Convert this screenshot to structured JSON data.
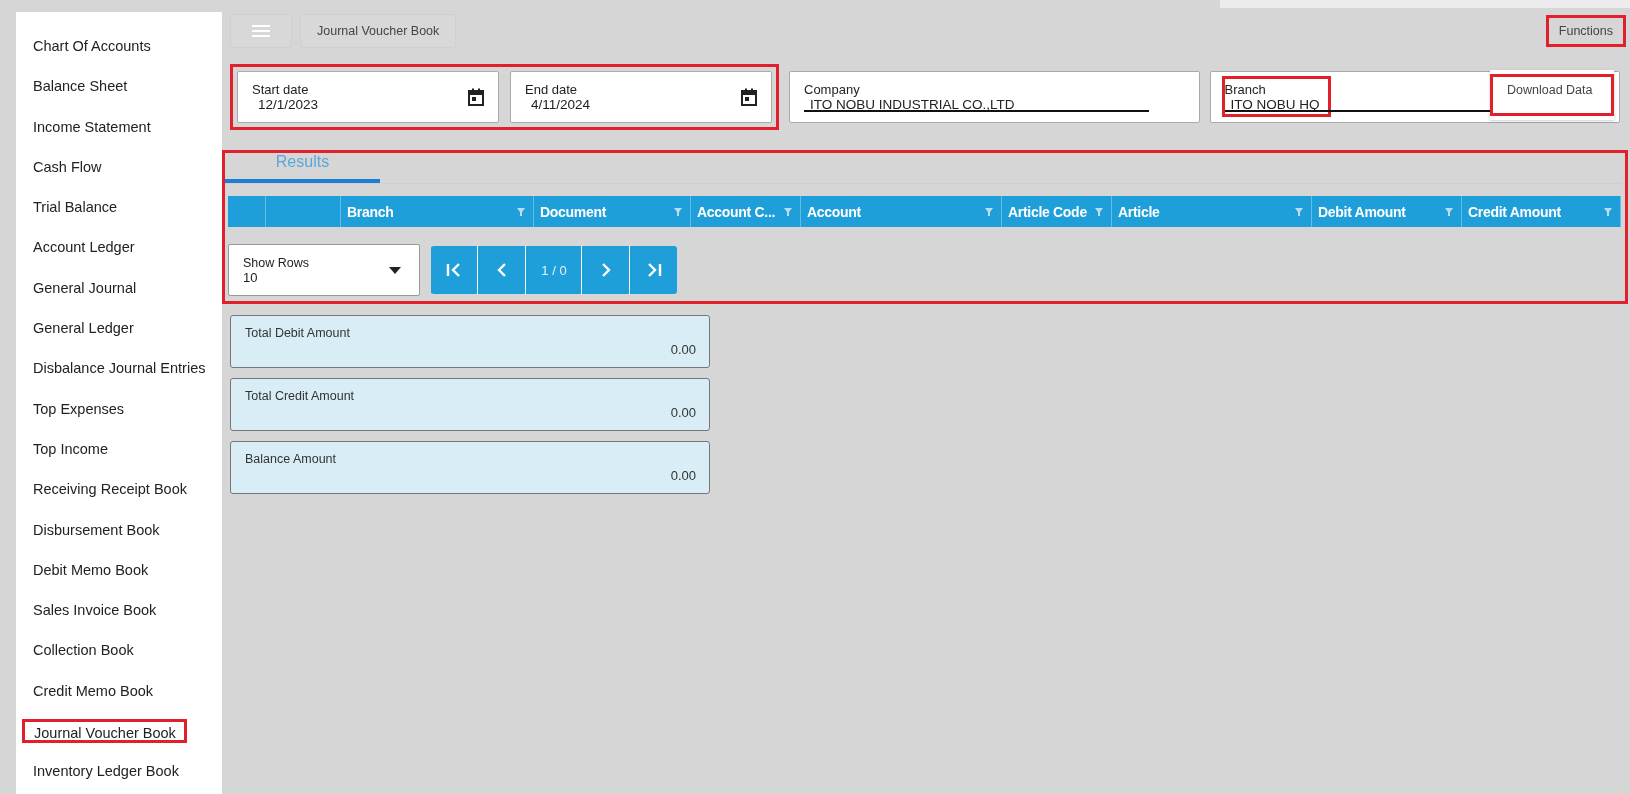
{
  "sidebar": {
    "items": [
      {
        "label": "Chart Of Accounts",
        "highlighted": false
      },
      {
        "label": "Balance Sheet",
        "highlighted": false
      },
      {
        "label": "Income Statement",
        "highlighted": false
      },
      {
        "label": "Cash Flow",
        "highlighted": false
      },
      {
        "label": "Trial Balance",
        "highlighted": false
      },
      {
        "label": "Account Ledger",
        "highlighted": false
      },
      {
        "label": "General Journal",
        "highlighted": false
      },
      {
        "label": "General Ledger",
        "highlighted": false
      },
      {
        "label": "Disbalance Journal Entries",
        "highlighted": false
      },
      {
        "label": "Top Expenses",
        "highlighted": false
      },
      {
        "label": "Top Income",
        "highlighted": false
      },
      {
        "label": "Receiving Receipt Book",
        "highlighted": false
      },
      {
        "label": "Disbursement Book",
        "highlighted": false
      },
      {
        "label": "Debit Memo Book",
        "highlighted": false
      },
      {
        "label": "Sales Invoice Book",
        "highlighted": false
      },
      {
        "label": "Collection Book",
        "highlighted": false
      },
      {
        "label": "Credit Memo Book",
        "highlighted": false
      },
      {
        "label": "Journal Voucher Book",
        "highlighted": true
      },
      {
        "label": "Inventory Ledger Book",
        "highlighted": false
      }
    ]
  },
  "toolbar": {
    "title": "Journal Voucher Book",
    "functions": {
      "label": "Functions",
      "highlighted": true
    },
    "menu": [
      {
        "label": "Download Data",
        "highlighted": true
      }
    ]
  },
  "filters": {
    "date_range_highlighted": true,
    "fields": [
      {
        "kind": "date",
        "label": "Start date",
        "value": "12/1/2023",
        "highlighted": false
      },
      {
        "kind": "date",
        "label": "End date",
        "value": "4/11/2024",
        "highlighted": false
      },
      {
        "kind": "select",
        "label": "Company",
        "value": "ITO NOBU INDUSTRIAL CO.,LTD",
        "highlighted": false
      },
      {
        "kind": "select",
        "label": "Branch",
        "value": "ITO NOBU HQ",
        "highlighted": true
      }
    ]
  },
  "results": {
    "highlighted": true,
    "tabs": [
      {
        "label": "Results",
        "selected": true
      }
    ],
    "columns": [
      {
        "filter": false
      },
      {
        "filter": false
      },
      {
        "label": "Branch",
        "filter": true
      },
      {
        "label": "Document",
        "filter": true
      },
      {
        "label": "Account C...",
        "filter": true
      },
      {
        "label": "Account",
        "filter": true
      },
      {
        "label": "Article Code",
        "filter": true
      },
      {
        "label": "Article",
        "filter": true
      },
      {
        "label": "Debit Amount",
        "filter": true
      },
      {
        "label": "Credit Amount",
        "filter": true
      }
    ],
    "show_rows": {
      "label": "Show Rows",
      "value": "10"
    },
    "page": "1 / 0"
  },
  "totals": [
    {
      "label": "Total Debit Amount",
      "value": "0.00"
    },
    {
      "label": "Total Credit Amount",
      "value": "0.00"
    },
    {
      "label": "Balance Amount",
      "value": "0.00"
    }
  ]
}
